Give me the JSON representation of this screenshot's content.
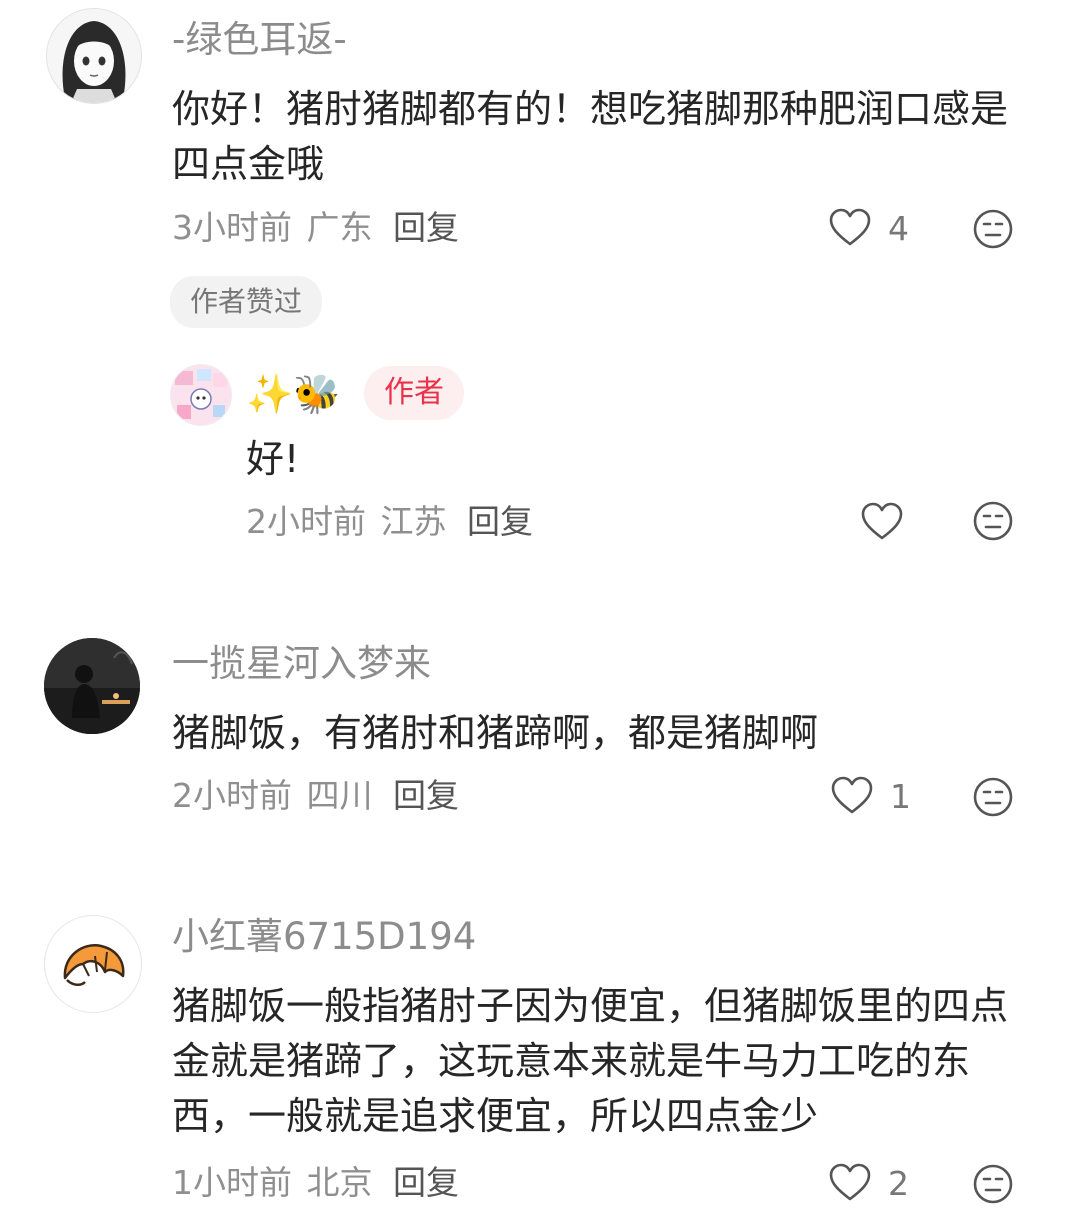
{
  "comments": [
    {
      "username": "-绿色耳返-",
      "text": "你好！猪肘猪脚都有的！想吃猪脚那种肥润口感是四点金哦",
      "time": "3小时前",
      "location": "广东",
      "reply_label": "回复",
      "likes": "4",
      "badge": "作者赞过",
      "avatar_icon": "anime-girl-avatar",
      "replies": [
        {
          "username": "✨🐝",
          "tag": "作者",
          "text": "好!",
          "time": "2小时前",
          "location": "江苏",
          "reply_label": "回复",
          "likes": "",
          "avatar_icon": "sticker-collage-avatar"
        }
      ]
    },
    {
      "username": "一揽星河入梦来",
      "text": "猪脚饭，有猪肘和猪蹄啊，都是猪脚啊",
      "time": "2小时前",
      "location": "四川",
      "reply_label": "回复",
      "likes": "1",
      "avatar_icon": "dark-silhouette-avatar"
    },
    {
      "username": "小红薯6715D194",
      "text": "猪脚饭一般指猪肘子因为便宜，但猪脚饭里的四点金就是猪蹄了，这玩意本来就是牛马力工吃的东西，一般就是追求便宜，所以四点金少",
      "time": "1小时前",
      "location": "北京",
      "reply_label": "回复",
      "likes": "2",
      "avatar_icon": "croissant-avatar"
    }
  ],
  "colors": {
    "text": "#262626",
    "meta": "#8f8f8f",
    "author_tag_bg": "#fdeef0",
    "author_tag_text": "#e8344a"
  }
}
